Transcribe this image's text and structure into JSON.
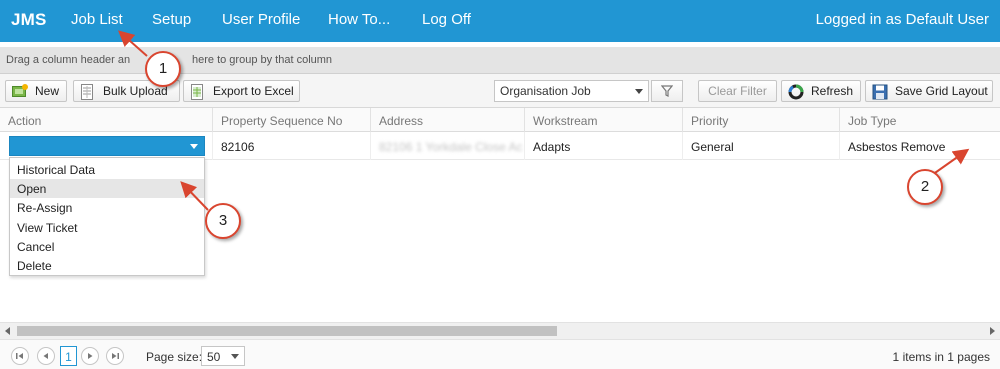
{
  "nav": {
    "brand": "JMS",
    "items": [
      "Job List",
      "Setup",
      "User Profile",
      "How To...",
      "Log Off"
    ],
    "logged_in": "Logged in as Default User"
  },
  "group_panel": {
    "text": "Drag a column header and drop it here to group by that column",
    "visible_start": "Drag a column header an",
    "visible_end": "here to group by that column"
  },
  "toolbar": {
    "new_label": "New",
    "bulk_upload_label": "Bulk Upload",
    "export_label": "Export to Excel",
    "view_select": "Organisation Job",
    "clear_filter_label": "Clear Filter",
    "refresh_label": "Refresh",
    "save_layout_label": "Save Grid Layout"
  },
  "grid": {
    "columns": [
      "Action",
      "Property Sequence No",
      "Address",
      "Workstream",
      "Priority",
      "Job Type"
    ],
    "row": {
      "action": "",
      "property_sequence_no": "82106",
      "address": "82106 1 Yorkdale Close Ac",
      "workstream": "Adapts",
      "priority": "General",
      "job_type": "Asbestos Remove"
    }
  },
  "action_menu": {
    "items": [
      "Historical Data",
      "Open",
      "Re-Assign",
      "View Ticket",
      "Cancel",
      "Delete"
    ],
    "hovered": "Open"
  },
  "pager": {
    "current_page": "1",
    "page_size_label": "Page size:",
    "page_size": "50",
    "info_count": "1",
    "info_text": "items in",
    "info_pages": "1",
    "info_pages_text": "pages"
  },
  "callouts": [
    "1",
    "2",
    "3"
  ],
  "colors": {
    "header_blue": "#2196d3",
    "callout_red": "#d9452f"
  },
  "icons": {
    "new": "new-icon",
    "bulk_upload": "spreadsheet-icon",
    "export": "excel-icon",
    "filter": "filter-icon",
    "refresh": "refresh-icon",
    "save": "save-icon"
  }
}
